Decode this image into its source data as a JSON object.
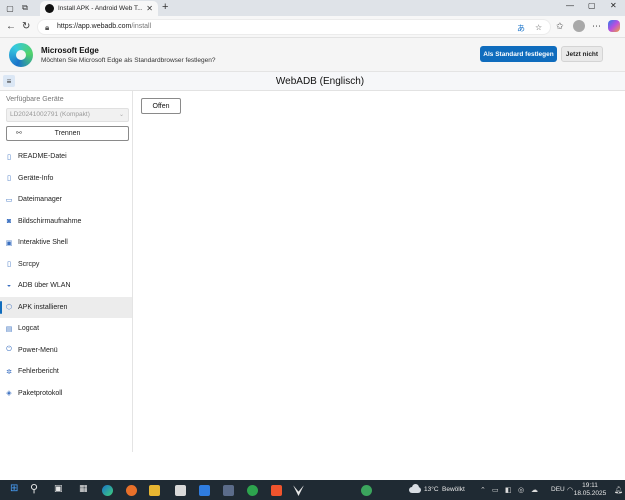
{
  "browser": {
    "tab_title": "Install APK - Android Web T...",
    "url_host": "https://app.webadb.com",
    "url_path": "/install",
    "colors": {
      "accent": "#0f6cbd",
      "taskbar": "#1f2a33"
    }
  },
  "banner": {
    "heading": "Microsoft Edge",
    "subtext": "Möchten Sie Microsoft Edge als Standardbrowser festlegen?",
    "primary_label": "Als Standard festlegen",
    "secondary_label": "Jetzt nicht"
  },
  "app": {
    "title": "WebADB (Englisch)"
  },
  "sidebar": {
    "devices_label": "Verfügbare Geräte",
    "device_selected": "LD20241002791 (Kompakt)",
    "disconnect_label": "Trennen",
    "items": [
      {
        "label": "README-Datei",
        "icon": "document-icon",
        "glyph": "▯"
      },
      {
        "label": "Geräte-Info",
        "icon": "phone-icon",
        "glyph": "▯"
      },
      {
        "label": "Dateimanager",
        "icon": "folder-icon",
        "glyph": "▭"
      },
      {
        "label": "Bildschirmaufnahme",
        "icon": "camera-icon",
        "glyph": "◙"
      },
      {
        "label": "Interaktive Shell",
        "icon": "terminal-icon",
        "glyph": "▣"
      },
      {
        "label": "Scrcpy",
        "icon": "screen-mirror-icon",
        "glyph": "▯"
      },
      {
        "label": "ADB über WLAN",
        "icon": "wifi-icon",
        "glyph": "◒"
      },
      {
        "label": "APK installieren",
        "icon": "package-icon",
        "glyph": "⬡",
        "active": true
      },
      {
        "label": "Logcat",
        "icon": "list-icon",
        "glyph": "▤"
      },
      {
        "label": "Power-Menü",
        "icon": "power-icon",
        "glyph": "⏻"
      },
      {
        "label": "Fehlerbericht",
        "icon": "bug-icon",
        "glyph": "✲"
      },
      {
        "label": "Paketprotokoll",
        "icon": "network-icon",
        "glyph": "◈"
      }
    ]
  },
  "main": {
    "open_label": "Offen"
  },
  "taskbar": {
    "weather_temp": "13°C",
    "weather_text": "Bewölkt",
    "language": "DEU",
    "time": "19:11",
    "date": "18.05.2025"
  }
}
